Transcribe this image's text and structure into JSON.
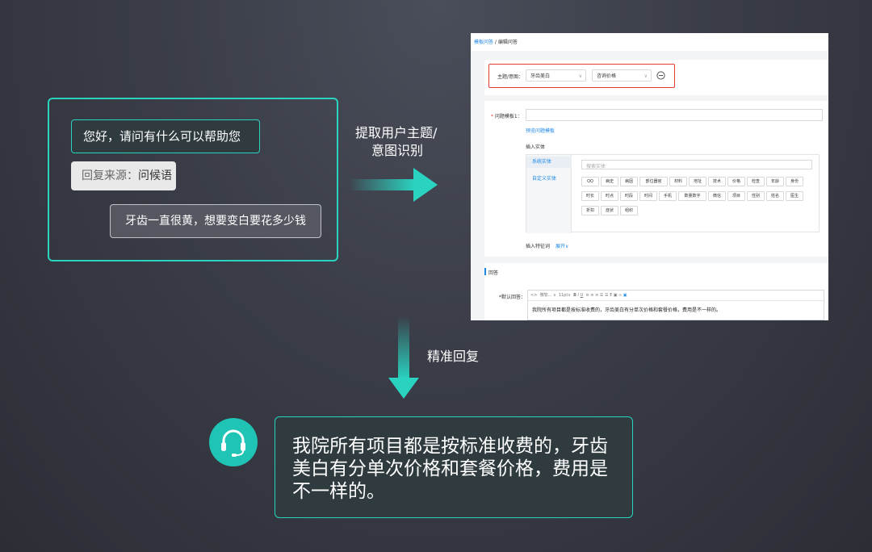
{
  "chat": {
    "greeting": "您好，请问有什么可以帮助您的？",
    "source_label": "回复来源：",
    "source_value": "问候语",
    "user_message": "牙齿一直很黄，想要变白要花多少钱"
  },
  "arrows": {
    "extract_line1": "提取用户主题/",
    "extract_line2": "意图识别",
    "precise_reply": "精准回复"
  },
  "admin": {
    "breadcrumb_link": "模板问答",
    "breadcrumb_sep": " / ",
    "breadcrumb_current": "编辑问答",
    "topic_label": "主题/意图：",
    "topic_value": "牙齿美白",
    "intent_value": "咨询价格",
    "question_label": "问题模板1：",
    "preview_link": "预览问题模板",
    "insert_entity": "插入实体",
    "tab_system": "系统实体",
    "tab_custom": "自定义实体",
    "search_placeholder": "搜索实体",
    "entities": [
      "QQ",
      "病史",
      "病因",
      "部位器官",
      "材料",
      "地址",
      "技术",
      "价格",
      "检查",
      "年龄",
      "身份",
      "时长",
      "时点",
      "时段",
      "时间",
      "手机",
      "数量数字",
      "微信",
      "项目",
      "性别",
      "姓名",
      "医生",
      "折扣",
      "症状",
      "组织"
    ],
    "insert_feature": "插入特征词",
    "expand": "展开",
    "answer_section": "回答",
    "default_answer_label": "*默认回答：",
    "toolbar_font": "微软...",
    "toolbar_size": "11pt",
    "answer_text": "我院所有项目都是按标准收费的，牙齿美白有分单次价格和套餐价格，费用是不一样的。"
  },
  "bottom": {
    "answer_line1": "我院所有项目都是按标准收费的，牙齿",
    "answer_line2": "美白有分单次价格和套餐价格，费用是",
    "answer_line3": "不一样的。"
  },
  "colors": {
    "accent": "#2ad3c0",
    "highlight_red": "#e53935",
    "link_blue": "#1e88e5"
  },
  "icons": {
    "support": "headset-icon",
    "remove": "minus-circle-icon"
  }
}
